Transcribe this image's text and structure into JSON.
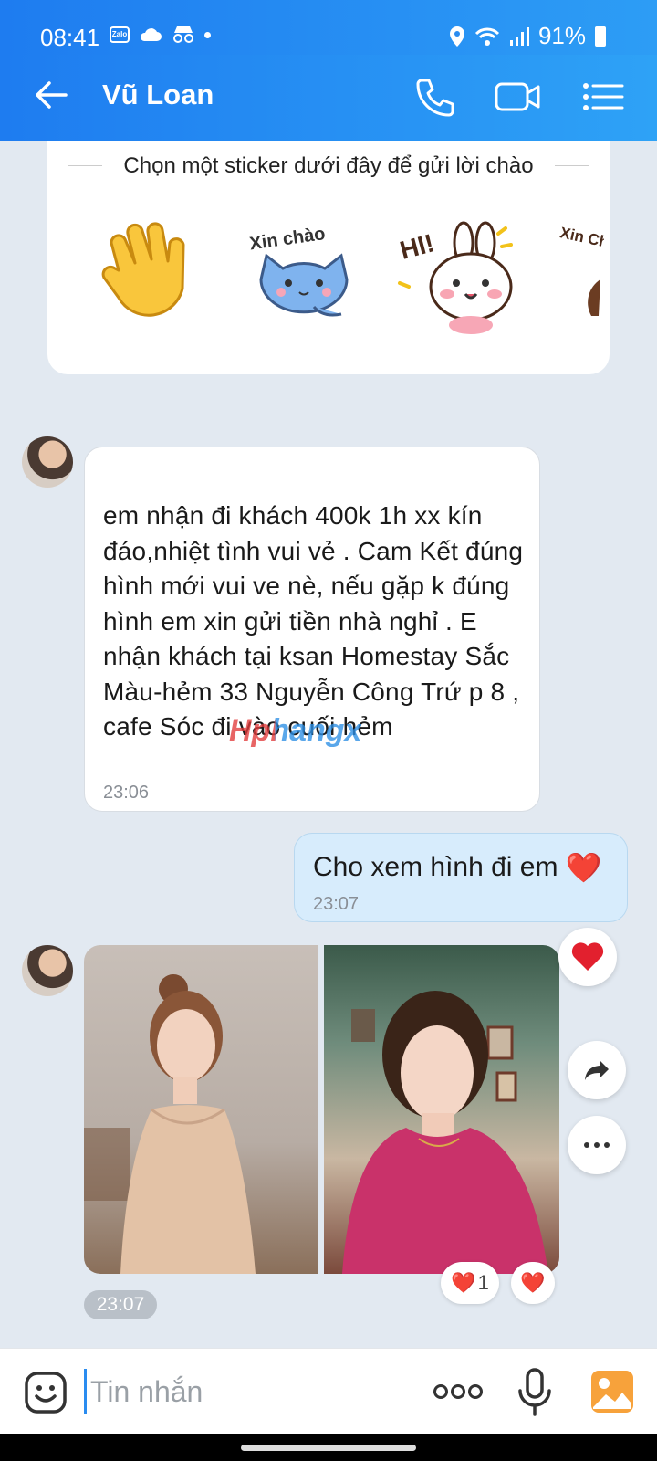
{
  "status_bar": {
    "time": "08:41",
    "battery": "91%",
    "icons": [
      "zalo-icon",
      "cloud-icon",
      "incognito-icon",
      "dot-icon",
      "location-icon",
      "wifi-icon",
      "signal-icon",
      "battery-icon"
    ]
  },
  "header": {
    "contact_name": "Vũ Loan",
    "icons": [
      "back-arrow-icon",
      "phone-icon",
      "video-call-icon",
      "menu-list-icon"
    ]
  },
  "sticker_panel": {
    "title": "Chọn một sticker dưới đây để gửi lời chào",
    "stickers": [
      {
        "name": "waving-hand-sticker",
        "text": ""
      },
      {
        "name": "xin-chao-cat-sticker",
        "text": "Xin chào"
      },
      {
        "name": "hi-bunny-sticker",
        "text": "HI!"
      },
      {
        "name": "xin-chao-partial-sticker",
        "text": "Xin Chà"
      }
    ]
  },
  "messages": [
    {
      "direction": "incoming",
      "text": "em nhận đi khách 400k 1h xx kín đáo,nhiệt tình vui vẻ . Cam Kết đúng hình mới vui ve nè, nếu gặp k đúng hình em xin gửi tiền nhà nghỉ . E nhận khách tại ksan Homestay Sắc Màu-hẻm 33 Nguyễn Công Trứ p 8 , cafe Sóc đi vào cuối hẻm",
      "time": "23:06",
      "watermark": "Hphangx"
    },
    {
      "direction": "outgoing",
      "text": "Cho xem hình đi em",
      "emoji": "❤️",
      "time": "23:07"
    },
    {
      "direction": "incoming",
      "type": "photos",
      "photo_count": 2,
      "time": "23:07",
      "reactions": [
        {
          "emoji": "❤️",
          "count": "1"
        },
        {
          "emoji": "❤️",
          "count": ""
        }
      ]
    }
  ],
  "actions": {
    "react_icon": "heart-icon",
    "forward_icon": "share-arrow-icon",
    "more_icon": "more-dots-icon"
  },
  "input_bar": {
    "placeholder": "Tin nhắn",
    "icons": [
      "emoji-sticker-icon",
      "more-options-icon",
      "microphone-icon",
      "image-gallery-icon"
    ]
  },
  "colors": {
    "header_blue": "#1e7cf0",
    "outgoing_bubble": "#d7ecfc",
    "heart_red": "#e2202e",
    "chat_bg": "#e2e9f1",
    "gallery_orange": "#f7a23b"
  }
}
